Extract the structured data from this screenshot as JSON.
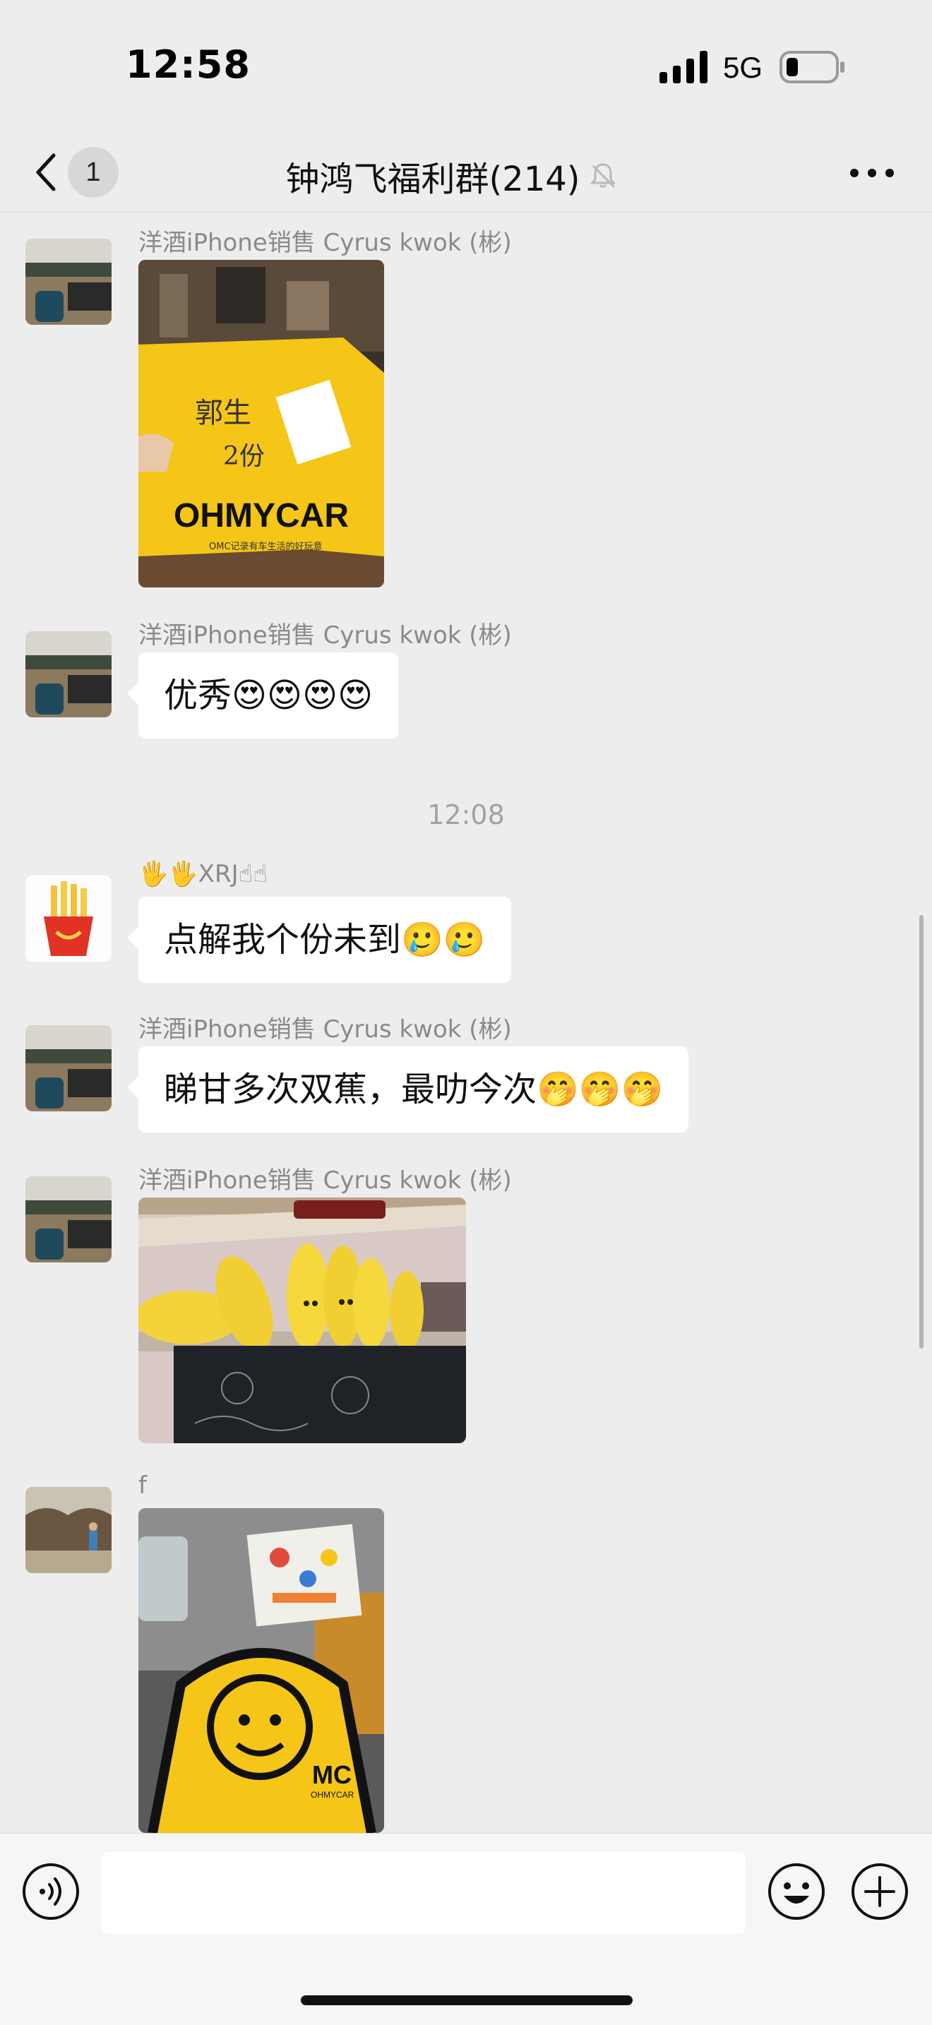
{
  "status_bar": {
    "time": "12:58",
    "network": "5G",
    "icons": [
      "signal-icon",
      "battery-icon"
    ]
  },
  "nav": {
    "back_icon": "chevron-left-icon",
    "unread_count": "1",
    "title": "钟鸿飞福利群(214)",
    "mute_icon": "bell-muted-icon",
    "more_icon": "more-dots-icon"
  },
  "messages": [
    {
      "sender": "洋酒iPhone销售  Cyrus kwok (彬)",
      "type": "image",
      "image_text": [
        "郭生",
        "2份",
        "OHMYCAR",
        "OMC记录有车生活的好玩意"
      ]
    },
    {
      "sender": "洋酒iPhone销售  Cyrus kwok (彬)",
      "type": "text",
      "text": "优秀😍😍😍😍"
    },
    {
      "sender": "🖐🖐XRJ☝☝",
      "type": "text",
      "text": "点解我个份未到🥲🥲"
    },
    {
      "sender": "洋酒iPhone销售  Cyrus kwok (彬)",
      "type": "text",
      "text": "睇甘多次双蕉，最叻今次🤭🤭🤭"
    },
    {
      "sender": "洋酒iPhone销售  Cyrus kwok (彬)",
      "type": "image"
    },
    {
      "sender": "f",
      "type": "image",
      "image_text": [
        "MC",
        "OHMYCAR"
      ]
    }
  ],
  "timestamp": "12:08",
  "input_bar": {
    "placeholder": "",
    "icons": [
      "voice-icon",
      "emoji-icon",
      "add-icon"
    ]
  },
  "colors": {
    "background": "#ededed",
    "bubble": "#ffffff",
    "sender_text": "#8a8a8a",
    "bag_yellow": "#f5c518"
  }
}
